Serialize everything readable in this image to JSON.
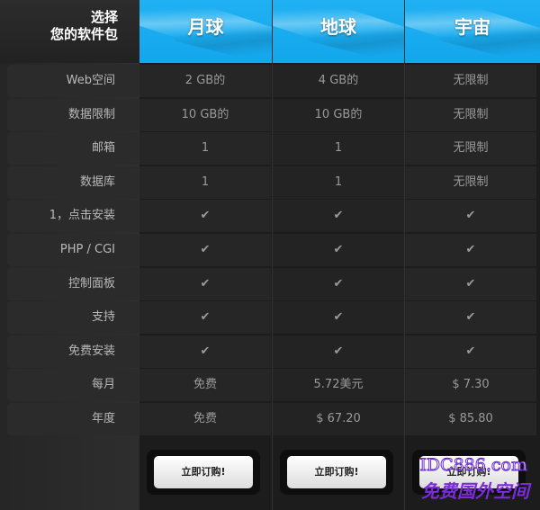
{
  "header": {
    "title_line1": "选择",
    "title_line2": "您的软件包",
    "plans": [
      "月球",
      "地球",
      "宇宙"
    ]
  },
  "rows": [
    {
      "label": "Web空间",
      "values": [
        "2 GB的",
        "4 GB的",
        "无限制"
      ]
    },
    {
      "label": "数据限制",
      "values": [
        "10 GB的",
        "10 GB的",
        "无限制"
      ]
    },
    {
      "label": "邮箱",
      "values": [
        "1",
        "1",
        "无限制"
      ]
    },
    {
      "label": "数据库",
      "values": [
        "1",
        "1",
        "无限制"
      ]
    },
    {
      "label": "1，点击安装",
      "values": [
        "✔",
        "✔",
        "✔"
      ]
    },
    {
      "label": "PHP / CGI",
      "values": [
        "✔",
        "✔",
        "✔"
      ]
    },
    {
      "label": "控制面板",
      "values": [
        "✔",
        "✔",
        "✔"
      ]
    },
    {
      "label": "支持",
      "values": [
        "✔",
        "✔",
        "✔"
      ]
    },
    {
      "label": "免费安装",
      "values": [
        "✔",
        "✔",
        "✔"
      ]
    },
    {
      "label": "每月",
      "values": [
        "免费",
        "5.72美元",
        "$ 7.30"
      ]
    },
    {
      "label": "年度",
      "values": [
        "免费",
        "$ 67.20",
        "$ 85.80"
      ]
    }
  ],
  "buttons": [
    "立即订购!",
    "立即订购!",
    "立即订购!"
  ],
  "watermark": {
    "line1": "IDC886.com",
    "line2": "免费国外空间"
  },
  "colors": {
    "header_blue": "#14a6ec",
    "check": "#3cc3f5"
  }
}
